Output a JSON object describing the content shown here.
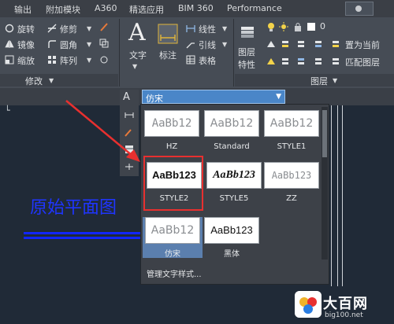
{
  "tabs": [
    "输出",
    "附加模块",
    "A360",
    "精选应用",
    "BIM 360",
    "Performance"
  ],
  "ribbon": {
    "modify": {
      "rotate": "旋转",
      "trim": "修剪",
      "mirror": "镜像",
      "fillet": "圆角",
      "scale": "缩放",
      "array": "阵列",
      "title": "修改"
    },
    "annotation": {
      "text": "文字",
      "dimension": "标注",
      "linear": "线性",
      "leader": "引线",
      "table": "表格"
    },
    "layers": {
      "properties_line1": "图层",
      "properties_line2": "特性",
      "layer_value": "0",
      "set_current": "置为当前",
      "match_layer": "匹配图层",
      "title": "图层"
    }
  },
  "text_style_dropdown": {
    "current": "仿宋",
    "styles": [
      {
        "label": "HZ",
        "preview": "AaBb12"
      },
      {
        "label": "Standard",
        "preview": "AaBb12"
      },
      {
        "label": "STYLE1",
        "preview": "AaBb12"
      },
      {
        "label": "STYLE2",
        "preview": "AaBb123"
      },
      {
        "label": "STYLE5",
        "preview": "AaBb123"
      },
      {
        "label": "ZZ",
        "preview": "AaBb123"
      },
      {
        "label": "仿宋",
        "preview": "AaBb12"
      },
      {
        "label": "黑体",
        "preview": "AaBb123"
      }
    ],
    "manage": "管理文字样式..."
  },
  "drawing": {
    "title": "原始平面图"
  },
  "watermark": {
    "name": "大百网",
    "url": "big100.net"
  },
  "colors": {
    "accent": "#4a86c8",
    "highlight": "#e8302f",
    "drawing_blue": "#1f35ff"
  }
}
